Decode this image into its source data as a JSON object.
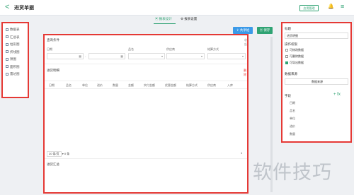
{
  "header": {
    "back": "<",
    "title": "进货单据",
    "manage_button": "应用管理",
    "bell_icon": "bell-icon",
    "menu_icon": "menu-icon"
  },
  "tabs": [
    {
      "label": "报表设计",
      "active": true
    },
    {
      "label": "报表设置",
      "active": false
    }
  ],
  "left_panel": {
    "items": [
      "数据表",
      "汇总表",
      "柱形图",
      "折线图",
      "饼图",
      "面积图",
      "雷达图"
    ]
  },
  "toolbar": {
    "share": "共享给",
    "save": "保存"
  },
  "query": {
    "title": "查询条件",
    "collapse": "收起",
    "fields": [
      {
        "label": "日期",
        "value": ""
      },
      {
        "label": "",
        "value": ""
      },
      {
        "label": "品名",
        "value": ""
      },
      {
        "label": "供应商",
        "value": ""
      },
      {
        "label": "结算方式",
        "value": ""
      }
    ]
  },
  "details": {
    "title": "进货明细",
    "delete": "删除",
    "columns": [
      "日期",
      "品名",
      "单位",
      "进价",
      "数量",
      "金额",
      "实付金额",
      "优惠金额",
      "结算方式",
      "供应商",
      "入库"
    ]
  },
  "pager": {
    "page_size": "20 条/页",
    "total": "0 条",
    "current": "1"
  },
  "summary": {
    "title": "进货汇总"
  },
  "right_panel": {
    "title_label": "标题",
    "title_value": "进货明细",
    "permission_label": "操作权限",
    "permissions": [
      {
        "label": "可修改数据",
        "checked": false
      },
      {
        "label": "可删除数据",
        "checked": false
      },
      {
        "label": "可导出数据",
        "checked": true
      }
    ],
    "datasource_label": "数据来源",
    "datasource_value": "数据来源",
    "fields_label": "字段",
    "add_label": "+ fx",
    "fields": [
      "日期",
      "品名",
      "单位",
      "进价",
      "数量"
    ]
  },
  "watermark": "软件技巧",
  "colors": {
    "accent": "#2fa373",
    "share": "#3b9ae8",
    "highlight": "#e53935"
  }
}
